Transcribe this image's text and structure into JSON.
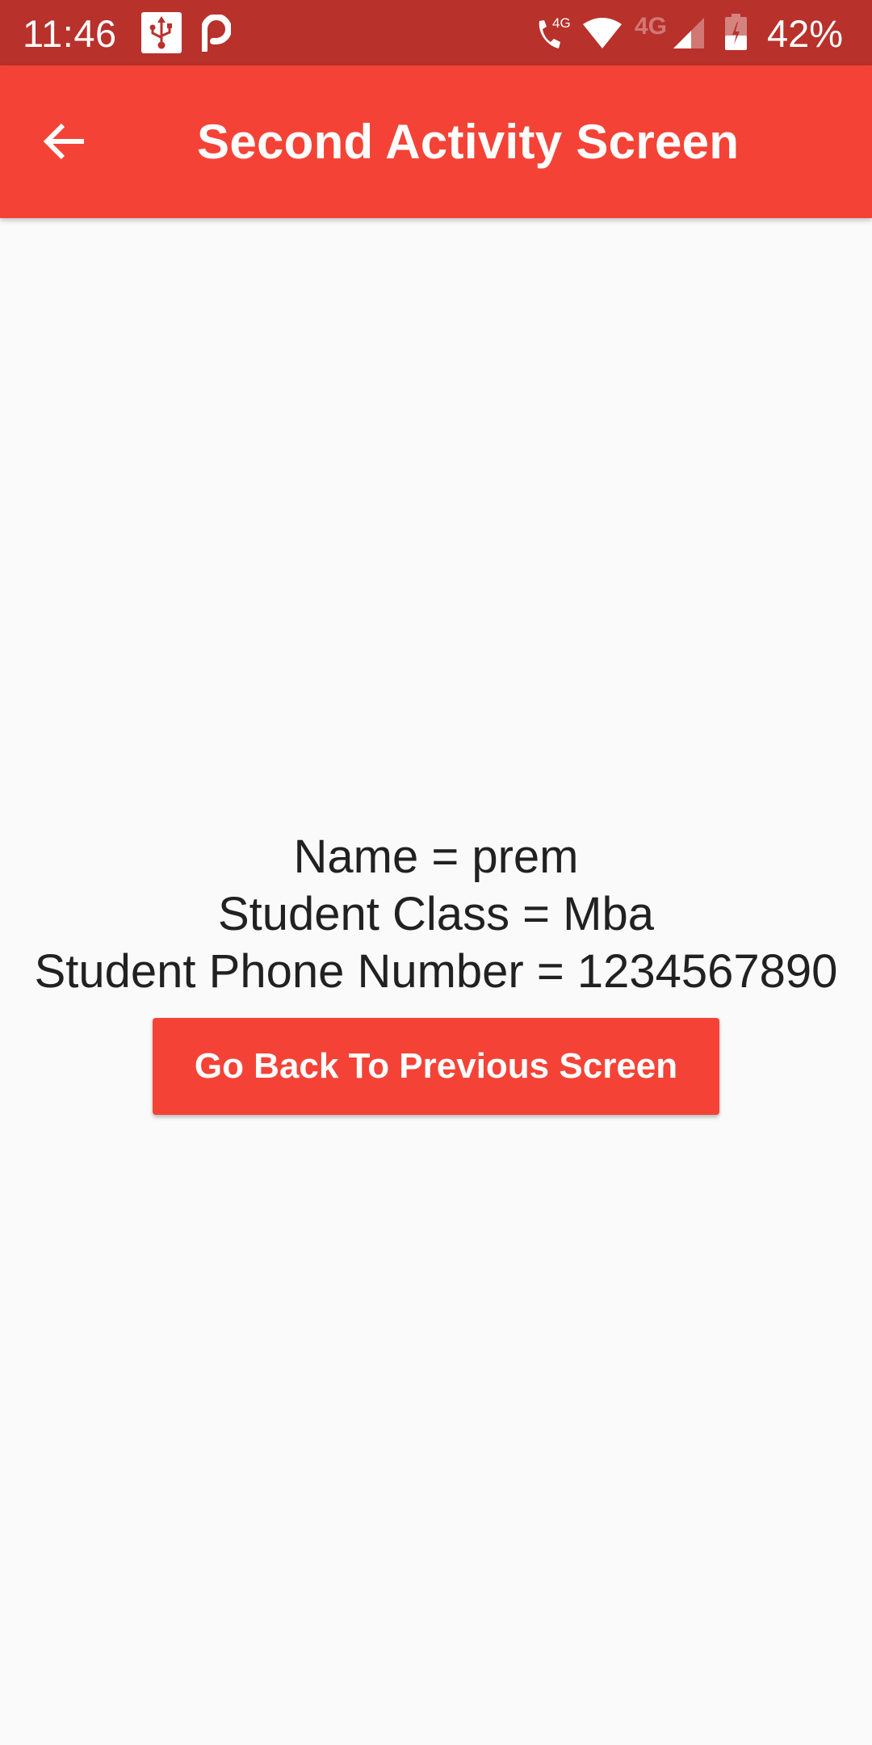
{
  "status_bar": {
    "time": "11:46",
    "notification_icons": [
      "usb-icon",
      "p-icon"
    ],
    "call_network_label": "4G",
    "data_network_label": "4G",
    "battery_percent": "42%",
    "color": "#B8312B"
  },
  "app_bar": {
    "title": "Second Activity Screen",
    "back_icon": "arrow-back-icon",
    "color": "#F44336"
  },
  "main": {
    "lines": [
      "Name = prem",
      "Student Class = Mba",
      "Student Phone Number = 1234567890"
    ],
    "button_label": "Go Back To Previous Screen",
    "button_color": "#F44336"
  }
}
